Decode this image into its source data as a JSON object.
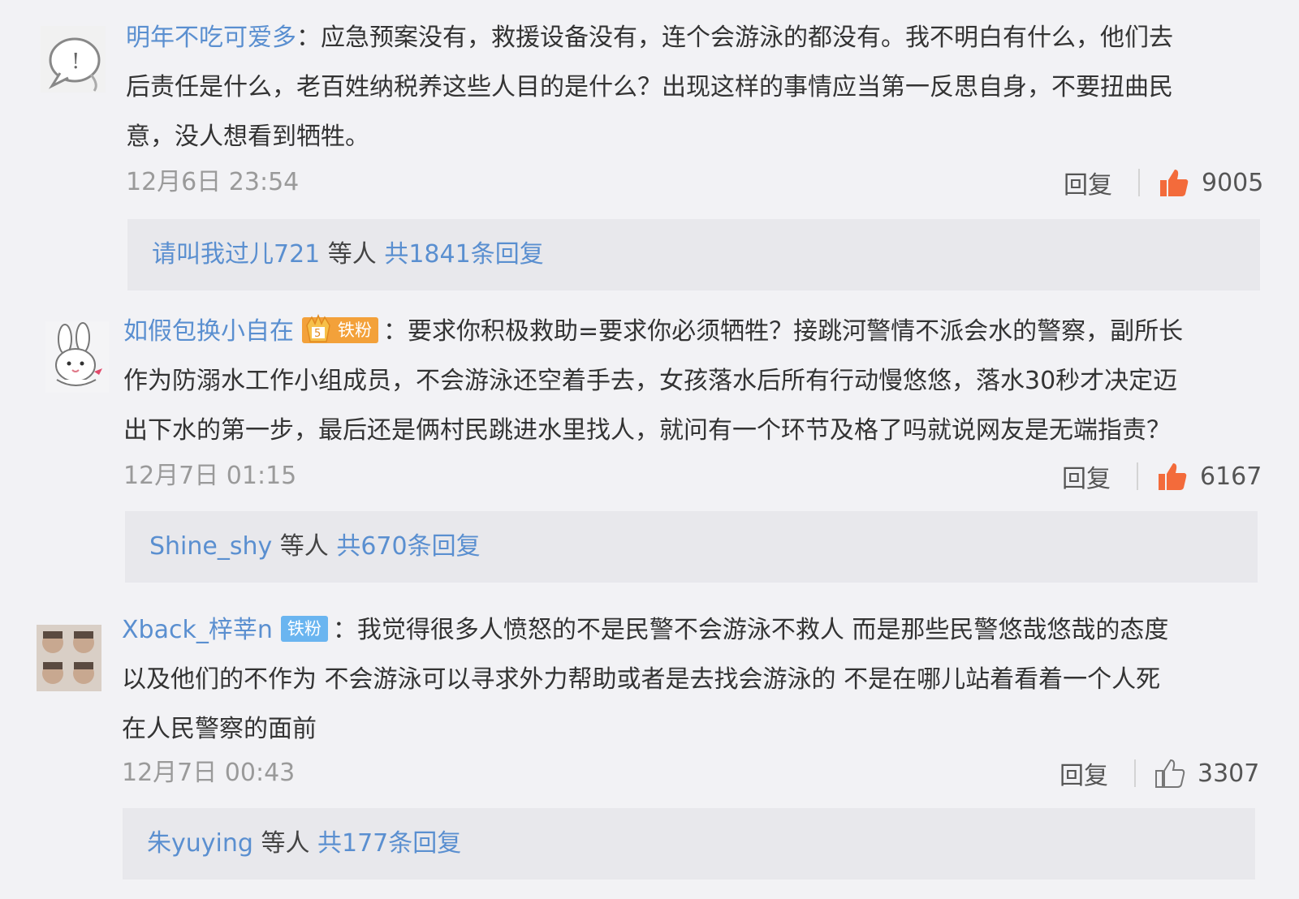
{
  "comments": [
    {
      "username": "明年不吃可爱多",
      "badge": "",
      "text_lines": [
        "：应急预案没有，救援设备没有，连个会游泳的都没有。我不明白有什么，他们去",
        "后责任是什么，老百姓纳税养这些人目的是什么？出现这样的事情应当第一反思自身，不要扭曲民",
        "意，没人想看到牺牲。"
      ],
      "time": "12月6日 23:54",
      "reply_label": "回复",
      "likes": "9005",
      "liked": true,
      "replies": {
        "user": "请叫我过儿721",
        "mid": " 等人 ",
        "total": "共1841条回复"
      }
    },
    {
      "username": "如假包换小自在",
      "badge": "铁粉",
      "badge_level": "5",
      "text_lines": [
        "：要求你积极救助=要求你必须牺牲？接跳河警情不派会水的警察，副所长",
        "作为防溺水工作小组成员，不会游泳还空着手去，女孩落水后所有行动慢悠悠，落水30秒才决定迈",
        "出下水的第一步，最后还是俩村民跳进水里找人，就问有一个环节及格了吗就说网友是无端指责？"
      ],
      "time": "12月7日 01:15",
      "reply_label": "回复",
      "likes": "6167",
      "liked": true,
      "replies": {
        "user": "Shine_shy",
        "mid": " 等人 ",
        "total": "共670条回复"
      }
    },
    {
      "username": "Xback_梓莘n",
      "badge": "铁粉",
      "text_lines": [
        "：我觉得很多人愤怒的不是民警不会游泳不救人 而是那些民警悠哉悠哉的态度",
        "以及他们的不作为 不会游泳可以寻求外力帮助或者是去找会游泳的 不是在哪儿站着看着一个人死",
        "在人民警察的面前"
      ],
      "time": "12月7日 00:43",
      "reply_label": "回复",
      "likes": "3307",
      "liked": false,
      "replies": {
        "user": "朱yuying",
        "mid": " 等人 ",
        "total": "共177条回复"
      }
    }
  ],
  "colors": {
    "link": "#5a8fd0",
    "like_active": "#f36b3b",
    "badge_orange": "#f3a13a",
    "badge_blue": "#6ab5f0"
  },
  "icons": [
    "thumbs-up-icon",
    "crown-icon"
  ]
}
